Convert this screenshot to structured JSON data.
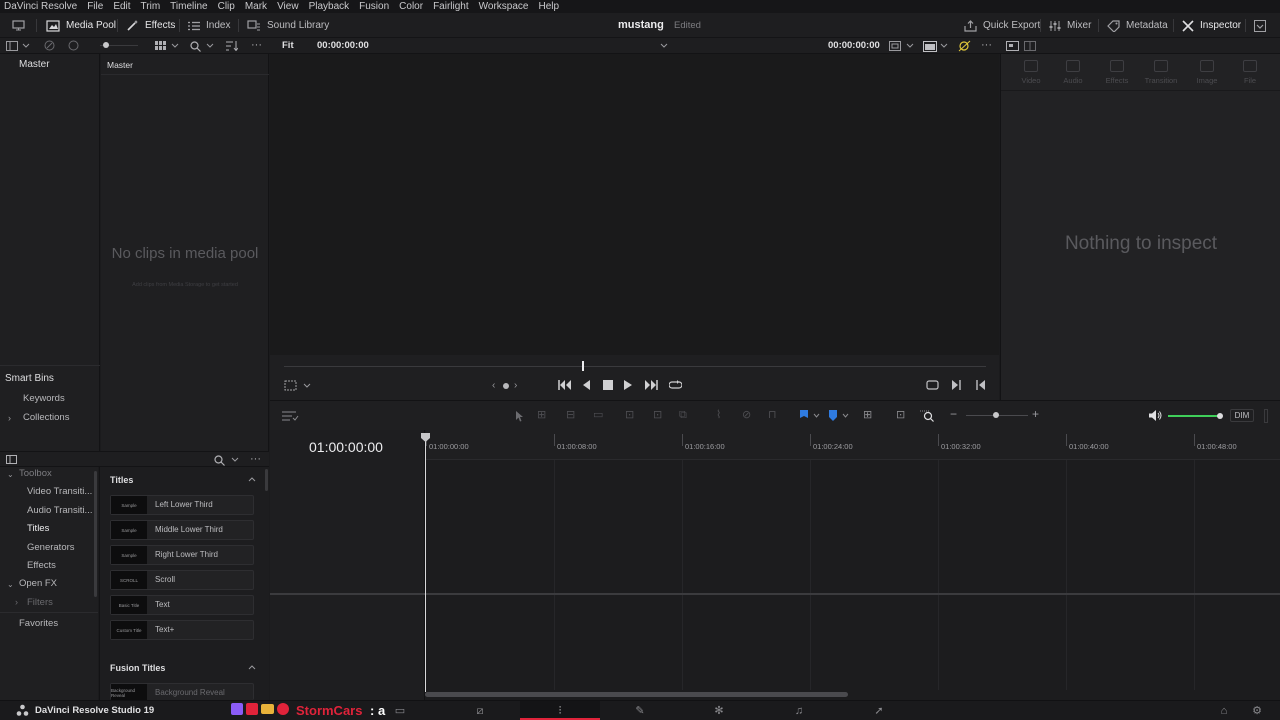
{
  "menu": [
    "DaVinci Resolve",
    "File",
    "Edit",
    "Trim",
    "Timeline",
    "Clip",
    "Mark",
    "View",
    "Playback",
    "Fusion",
    "Color",
    "Fairlight",
    "Workspace",
    "Help"
  ],
  "toolbar": {
    "media_pool": "Media Pool",
    "effects": "Effects",
    "index": "Index",
    "sound_library": "Sound Library",
    "project_name": "mustang",
    "project_status": "Edited",
    "quick_export": "Quick Export",
    "mixer": "Mixer",
    "metadata": "Metadata",
    "inspector": "Inspector"
  },
  "subbar": {
    "fit": "Fit",
    "source_tc": "00:00:00:00",
    "record_tc": "00:00:00:00"
  },
  "bins": {
    "master_left": "Master",
    "master_pool": "Master",
    "empty_title": "No clips in media pool",
    "empty_hint": "Add clips from Media Storage to get started",
    "smart_bins": "Smart Bins",
    "keywords": "Keywords",
    "collections": "Collections"
  },
  "inspector": {
    "tabs": [
      "Video",
      "Audio",
      "Effects",
      "Transition",
      "Image",
      "File"
    ],
    "empty": "Nothing to inspect"
  },
  "effects": {
    "tree": {
      "toolbox": "Toolbox",
      "video_transitions": "Video Transiti...",
      "audio_transitions": "Audio Transiti...",
      "titles": "Titles",
      "generators": "Generators",
      "effects": "Effects",
      "open_fx": "Open FX",
      "filters": "Filters",
      "favorites": "Favorites"
    },
    "titles_header": "Titles",
    "titles": [
      {
        "thumb": "Sample",
        "label": "Left Lower Third"
      },
      {
        "thumb": "Sample",
        "label": "Middle Lower Third"
      },
      {
        "thumb": "Sample",
        "label": "Right Lower Third"
      },
      {
        "thumb": "SCROLL",
        "label": "Scroll"
      },
      {
        "thumb": "Basic Title",
        "label": "Text"
      },
      {
        "thumb": "Custom Title",
        "label": "Text+"
      }
    ],
    "fusion_header": "Fusion Titles",
    "fusion_first": {
      "thumb": "Background Reveal",
      "label": "Background Reveal"
    }
  },
  "timeline": {
    "timecode": "01:00:00:00",
    "ruler": [
      "01:00:00:00",
      "01:00:08:00",
      "01:00:16:00",
      "01:00:24:00",
      "01:00:32:00",
      "01:00:40:00",
      "01:00:48:00"
    ],
    "dim_label": "DIM"
  },
  "bottom": {
    "app_name": "DaVinci Resolve Studio 19",
    "overlay_text": "StormCars",
    "overlay_suffix": ": a"
  },
  "colors": {
    "accent_red": "#e0233a",
    "flag_blue": "#2f7be0",
    "volume_green": "#3fcf5a"
  }
}
